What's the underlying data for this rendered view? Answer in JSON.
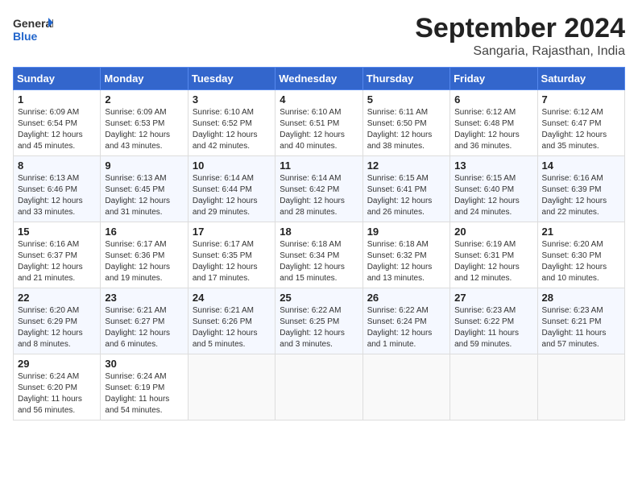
{
  "header": {
    "logo_general": "General",
    "logo_blue": "Blue",
    "month": "September 2024",
    "location": "Sangaria, Rajasthan, India"
  },
  "days_of_week": [
    "Sunday",
    "Monday",
    "Tuesday",
    "Wednesday",
    "Thursday",
    "Friday",
    "Saturday"
  ],
  "weeks": [
    [
      {
        "day": 1,
        "sunrise": "6:09 AM",
        "sunset": "6:54 PM",
        "daylight": "12 hours and 45 minutes."
      },
      {
        "day": 2,
        "sunrise": "6:09 AM",
        "sunset": "6:53 PM",
        "daylight": "12 hours and 43 minutes."
      },
      {
        "day": 3,
        "sunrise": "6:10 AM",
        "sunset": "6:52 PM",
        "daylight": "12 hours and 42 minutes."
      },
      {
        "day": 4,
        "sunrise": "6:10 AM",
        "sunset": "6:51 PM",
        "daylight": "12 hours and 40 minutes."
      },
      {
        "day": 5,
        "sunrise": "6:11 AM",
        "sunset": "6:50 PM",
        "daylight": "12 hours and 38 minutes."
      },
      {
        "day": 6,
        "sunrise": "6:12 AM",
        "sunset": "6:48 PM",
        "daylight": "12 hours and 36 minutes."
      },
      {
        "day": 7,
        "sunrise": "6:12 AM",
        "sunset": "6:47 PM",
        "daylight": "12 hours and 35 minutes."
      }
    ],
    [
      {
        "day": 8,
        "sunrise": "6:13 AM",
        "sunset": "6:46 PM",
        "daylight": "12 hours and 33 minutes."
      },
      {
        "day": 9,
        "sunrise": "6:13 AM",
        "sunset": "6:45 PM",
        "daylight": "12 hours and 31 minutes."
      },
      {
        "day": 10,
        "sunrise": "6:14 AM",
        "sunset": "6:44 PM",
        "daylight": "12 hours and 29 minutes."
      },
      {
        "day": 11,
        "sunrise": "6:14 AM",
        "sunset": "6:42 PM",
        "daylight": "12 hours and 28 minutes."
      },
      {
        "day": 12,
        "sunrise": "6:15 AM",
        "sunset": "6:41 PM",
        "daylight": "12 hours and 26 minutes."
      },
      {
        "day": 13,
        "sunrise": "6:15 AM",
        "sunset": "6:40 PM",
        "daylight": "12 hours and 24 minutes."
      },
      {
        "day": 14,
        "sunrise": "6:16 AM",
        "sunset": "6:39 PM",
        "daylight": "12 hours and 22 minutes."
      }
    ],
    [
      {
        "day": 15,
        "sunrise": "6:16 AM",
        "sunset": "6:37 PM",
        "daylight": "12 hours and 21 minutes."
      },
      {
        "day": 16,
        "sunrise": "6:17 AM",
        "sunset": "6:36 PM",
        "daylight": "12 hours and 19 minutes."
      },
      {
        "day": 17,
        "sunrise": "6:17 AM",
        "sunset": "6:35 PM",
        "daylight": "12 hours and 17 minutes."
      },
      {
        "day": 18,
        "sunrise": "6:18 AM",
        "sunset": "6:34 PM",
        "daylight": "12 hours and 15 minutes."
      },
      {
        "day": 19,
        "sunrise": "6:18 AM",
        "sunset": "6:32 PM",
        "daylight": "12 hours and 13 minutes."
      },
      {
        "day": 20,
        "sunrise": "6:19 AM",
        "sunset": "6:31 PM",
        "daylight": "12 hours and 12 minutes."
      },
      {
        "day": 21,
        "sunrise": "6:20 AM",
        "sunset": "6:30 PM",
        "daylight": "12 hours and 10 minutes."
      }
    ],
    [
      {
        "day": 22,
        "sunrise": "6:20 AM",
        "sunset": "6:29 PM",
        "daylight": "12 hours and 8 minutes."
      },
      {
        "day": 23,
        "sunrise": "6:21 AM",
        "sunset": "6:27 PM",
        "daylight": "12 hours and 6 minutes."
      },
      {
        "day": 24,
        "sunrise": "6:21 AM",
        "sunset": "6:26 PM",
        "daylight": "12 hours and 5 minutes."
      },
      {
        "day": 25,
        "sunrise": "6:22 AM",
        "sunset": "6:25 PM",
        "daylight": "12 hours and 3 minutes."
      },
      {
        "day": 26,
        "sunrise": "6:22 AM",
        "sunset": "6:24 PM",
        "daylight": "12 hours and 1 minute."
      },
      {
        "day": 27,
        "sunrise": "6:23 AM",
        "sunset": "6:22 PM",
        "daylight": "11 hours and 59 minutes."
      },
      {
        "day": 28,
        "sunrise": "6:23 AM",
        "sunset": "6:21 PM",
        "daylight": "11 hours and 57 minutes."
      }
    ],
    [
      {
        "day": 29,
        "sunrise": "6:24 AM",
        "sunset": "6:20 PM",
        "daylight": "11 hours and 56 minutes."
      },
      {
        "day": 30,
        "sunrise": "6:24 AM",
        "sunset": "6:19 PM",
        "daylight": "11 hours and 54 minutes."
      },
      null,
      null,
      null,
      null,
      null
    ]
  ]
}
